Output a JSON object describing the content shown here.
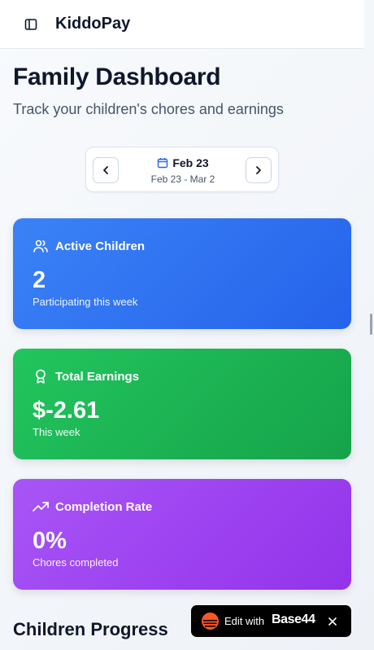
{
  "header": {
    "app_title": "KiddoPay",
    "sidebar_toggle_icon": "sidebar-panel-icon"
  },
  "page": {
    "title": "Family Dashboard",
    "subtitle": "Track your children's chores and earnings"
  },
  "week_nav": {
    "prev_icon": "chevron-left-icon",
    "next_icon": "chevron-right-icon",
    "calendar_icon": "calendar-icon",
    "current_label": "Feb 23",
    "range": "Feb 23 - Mar 2"
  },
  "cards": {
    "active_children": {
      "label": "Active Children",
      "value": "2",
      "caption": "Participating this week",
      "icon": "users-icon",
      "color": "#3b82f6"
    },
    "total_earnings": {
      "label": "Total Earnings",
      "value": "$-2.61",
      "caption": "This week",
      "icon": "award-icon",
      "color": "#22c55e"
    },
    "completion_rate": {
      "label": "Completion Rate",
      "value": "0%",
      "caption": "Chores completed",
      "icon": "trending-up-icon",
      "color": "#a855f7"
    }
  },
  "sections": {
    "children_progress": "Children Progress"
  },
  "edit_badge": {
    "text": "Edit with",
    "brand": "Base44",
    "logo_icon": "base44-logo-icon",
    "close_icon": "close-icon",
    "logo_color": "#ff5722"
  }
}
